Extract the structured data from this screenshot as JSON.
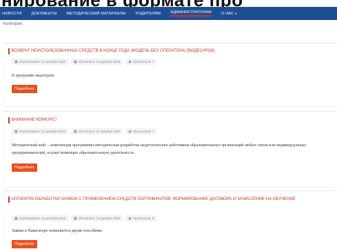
{
  "banner": {
    "text": "нирование в формате про"
  },
  "nav": {
    "items": [
      {
        "label": "Новости"
      },
      {
        "label": "Документы"
      },
      {
        "label": "Методический материалы"
      },
      {
        "label": "Родителям"
      },
      {
        "label": "Администраторам"
      },
      {
        "label": "О нас"
      }
    ],
    "active_index": 4,
    "accent_color": "#d0342c",
    "bar_color": "#1f4f93"
  },
  "breadcrumb": "Категория",
  "articles": [
    {
      "title": "Возврат неиспользованных средств в конце года (модель без оператора) [видеоурок]",
      "created": "Опубликовано: 22 декабря 2022",
      "updated": "Обновлено: 22 декабря 2022",
      "views": "Просмотров: 7",
      "excerpt": "В программе видеоурок:",
      "button": "Подробнее"
    },
    {
      "title": "Внимание конкурс!",
      "created": "Опубликовано: 21 декабря 2022",
      "updated": "Обновлено: 21 декабря 2022",
      "views": "Просмотров: 7",
      "excerpt": "Методический кейс – комплекция программно-методическая разработка педагогических работников образовательных организаций любых типов или индивидуальных предпринимателей, осуществляющих образовательную деятельность.",
      "button": "Подробнее"
    },
    {
      "title": "Алгоритм обработки заявок с применением средств сертификатов: формирование договора и зачисление на обучение",
      "created": "Опубликовано: 19 декабря 2022",
      "updated": "Обновлено: 19 декабря 2022",
      "views": "Просмотров: 8",
      "excerpt": "Заявки в Навигаторе поменяются двумя способами:",
      "button": "Подробнее"
    }
  ],
  "icons": {
    "created": "calendar-icon",
    "updated": "calendar-icon",
    "views": "eye-icon",
    "caret": "chevron-down-icon"
  },
  "colors": {
    "title": "#c0392b",
    "button": "#e8501f"
  }
}
